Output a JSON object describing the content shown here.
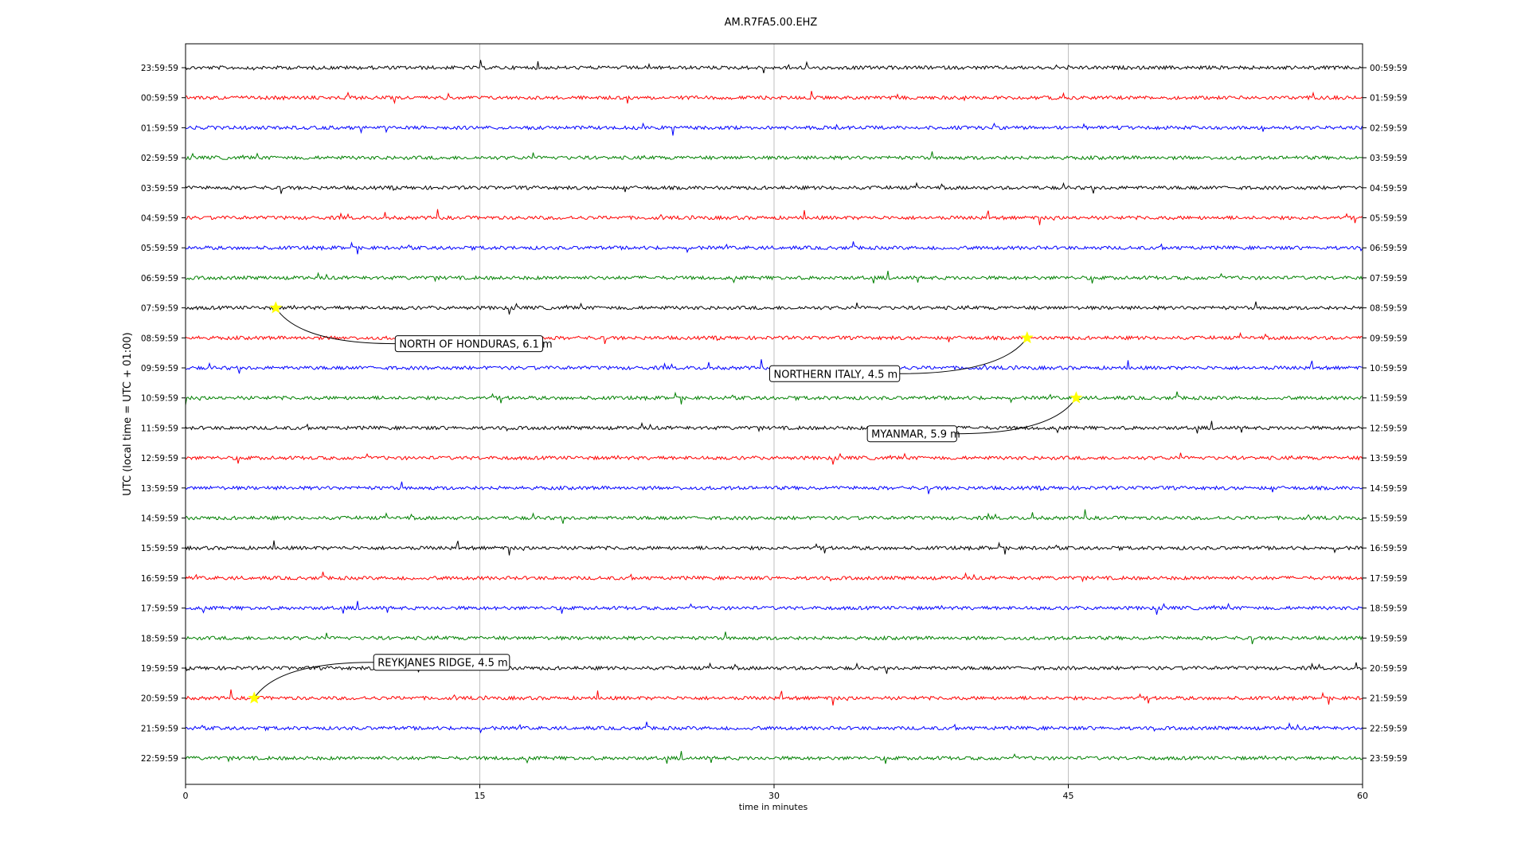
{
  "chart_data": {
    "type": "line",
    "title": "AM.R7FA5.00.EHZ",
    "xlabel": "time in minutes",
    "ylabel": "UTC (local time = UTC + 01:00)",
    "xlim": [
      0,
      60
    ],
    "x_ticks": [
      "0",
      "15",
      "30",
      "45",
      "60"
    ],
    "grid": "vertical lines at 15-minute ticks",
    "trace_colors": [
      "#000000",
      "#ff0000",
      "#0000ff",
      "#008000"
    ],
    "left_labels": [
      "23:59:59",
      "00:59:59",
      "01:59:59",
      "02:59:59",
      "03:59:59",
      "04:59:59",
      "05:59:59",
      "06:59:59",
      "07:59:59",
      "08:59:59",
      "09:59:59",
      "10:59:59",
      "11:59:59",
      "12:59:59",
      "13:59:59",
      "14:59:59",
      "15:59:59",
      "16:59:59",
      "17:59:59",
      "18:59:59",
      "19:59:59",
      "20:59:59",
      "21:59:59",
      "22:59:59"
    ],
    "right_labels": [
      "00:59:59",
      "01:59:59",
      "02:59:59",
      "03:59:59",
      "04:59:59",
      "05:59:59",
      "06:59:59",
      "07:59:59",
      "08:59:59",
      "09:59:59",
      "10:59:59",
      "11:59:59",
      "12:59:59",
      "13:59:59",
      "14:59:59",
      "15:59:59",
      "16:59:59",
      "17:59:59",
      "18:59:59",
      "19:59:59",
      "20:59:59",
      "21:59:59",
      "22:59:59",
      "23:59:59"
    ],
    "events": [
      {
        "label": "NORTH OF HONDURAS, 6.1 m",
        "trace": 8,
        "minute": 4.6
      },
      {
        "label": "NORTHERN ITALY, 4.5 m",
        "trace": 9,
        "minute": 42.9
      },
      {
        "label": "MYANMAR, 5.9 m",
        "trace": 11,
        "minute": 45.4
      },
      {
        "label": "REYKJANES RIDGE, 4.5 m",
        "trace": 21,
        "minute": 3.5
      }
    ],
    "marker_color": "#ffff00"
  }
}
